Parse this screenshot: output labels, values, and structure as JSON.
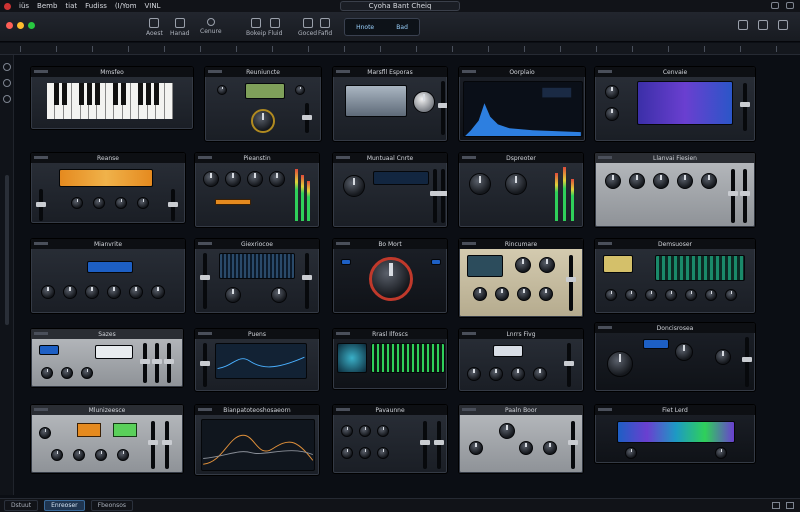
{
  "menubar": {
    "items": [
      "iüs",
      "Bemb",
      "tiat",
      "Fudiss",
      "(I/Yom",
      "VINL"
    ],
    "center_title": "Cyoha Bant Cheiq"
  },
  "toolbar": {
    "buttons": [
      {
        "label": "Aoest"
      },
      {
        "label": "Hanad"
      },
      {
        "label": "Cenure"
      },
      {
        "label": "Bokeip"
      },
      {
        "label": "Fluid"
      },
      {
        "label": "Goced"
      },
      {
        "label": "Fafid"
      }
    ],
    "lcd": {
      "left": "Hnote",
      "right": "Bad"
    }
  },
  "plugins": [
    {
      "title": "Mmsfeo"
    },
    {
      "title": "Reuniuncte"
    },
    {
      "title": "Marsfll Esporas"
    },
    {
      "title": "Oorplaio"
    },
    {
      "title": "Cenvaie"
    },
    {
      "title": "Reanse"
    },
    {
      "title": "Pieanstin"
    },
    {
      "title": "Muntuaal Cnrte"
    },
    {
      "title": "Dspreoter"
    },
    {
      "title": "Llanvai Fiesien"
    },
    {
      "title": "Mianvrite"
    },
    {
      "title": "Giexriocoe"
    },
    {
      "title": "Bo Mort"
    },
    {
      "title": "Rincumare"
    },
    {
      "title": "Demsuoser"
    },
    {
      "title": "Sazes"
    },
    {
      "title": "Puens"
    },
    {
      "title": "Rrasl Ilfoscs"
    },
    {
      "title": "Lnrrs Fivg"
    },
    {
      "title": "Doncisrosea"
    },
    {
      "title": "Mlunizeesce"
    },
    {
      "title": "Bianpatoteoshosaeorn"
    },
    {
      "title": "Pavaunne"
    },
    {
      "title": "Paaln Boor"
    },
    {
      "title": "Fiet Lerd"
    }
  ],
  "statusbar": {
    "tabs": [
      "Dstuut",
      "Enreoser",
      "Fbeonsos"
    ]
  },
  "colors": {
    "background": "#0b0e14",
    "panel_dark": "#1a1e25",
    "accent_orange": "#e58a1f",
    "accent_green": "#5ad05a",
    "screen_blue": "#1d5fc4"
  }
}
